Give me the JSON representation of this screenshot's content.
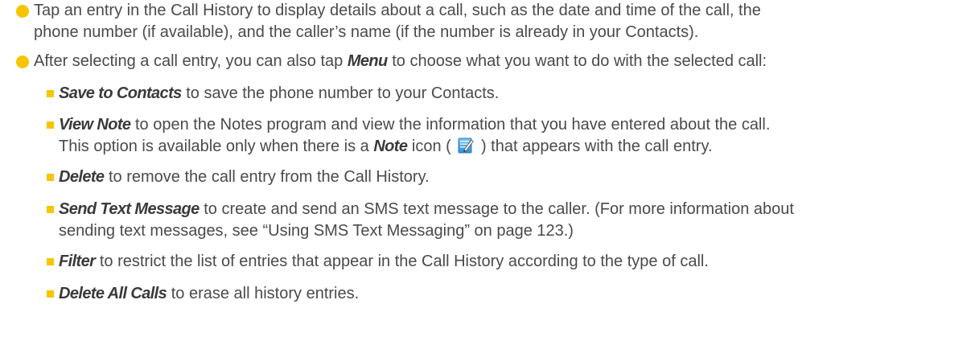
{
  "bullets": [
    {
      "line1": "Tap an entry in the Call History to display details about a call, such as the date and time of the call, the",
      "line2": "phone number (if available), and the caller’s name (if the number is already in your Contacts)."
    },
    {
      "pre": "After selecting a call entry, you can also tap ",
      "em": "Menu",
      "post": " to choose what you want to do with the selected call:"
    }
  ],
  "options": [
    {
      "em": "Save to Contacts",
      "text": " to save the phone number to your Contacts."
    },
    {
      "em": "View Note",
      "text": " to open the Notes program and view the information that you have entered about the call.",
      "line2_pre": "This option is available only when there is a ",
      "line2_em": "Note",
      "line2_mid": " icon ( ",
      "line2_post": " ) that appears with the call entry."
    },
    {
      "em": "Delete",
      "text": " to remove the call entry from the Call History."
    },
    {
      "em": "Send Text Message",
      "text": " to create and send an SMS text message to the caller. (For more information about",
      "line2": "sending text messages, see “Using SMS Text Messaging” on page 123.)"
    },
    {
      "em": "Filter",
      "text": " to restrict the list of entries that appear in the Call History according to the type of call."
    },
    {
      "em": "Delete All Calls",
      "text": " to erase all history entries."
    }
  ],
  "colors": {
    "bullet": "#f6c500",
    "text": "#4a4a4a"
  },
  "icons": {
    "note": "note-pad-pencil-icon"
  }
}
